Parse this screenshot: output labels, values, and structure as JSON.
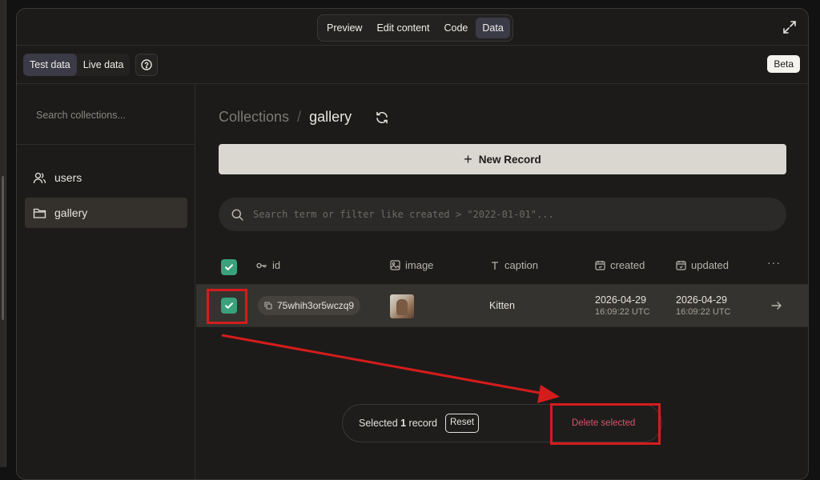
{
  "top_tabs": [
    "Preview",
    "Edit content",
    "Code",
    "Data"
  ],
  "active_top_tab": "Data",
  "env_tabs": [
    "Test data",
    "Live data"
  ],
  "active_env_tab": "Test data",
  "beta_label": "Beta",
  "sidebar": {
    "search_placeholder": "Search collections...",
    "items": [
      {
        "label": "users",
        "icon": "users-icon"
      },
      {
        "label": "gallery",
        "icon": "folder-icon",
        "active": true
      }
    ]
  },
  "breadcrumb": {
    "root": "Collections",
    "separator": "/",
    "current": "gallery"
  },
  "new_record_label": "New Record",
  "search": {
    "placeholder": "Search term or filter like created > \"2022-01-01\"..."
  },
  "table": {
    "columns": [
      {
        "label": "id",
        "icon": "key-icon"
      },
      {
        "label": "image",
        "icon": "image-icon"
      },
      {
        "label": "caption",
        "icon": "text-icon"
      },
      {
        "label": "created",
        "icon": "calendar-icon"
      },
      {
        "label": "updated",
        "icon": "calendar-icon"
      }
    ],
    "more_label": "···",
    "rows": [
      {
        "selected": true,
        "id": "75whih3or5wczq9",
        "caption": "Kitten",
        "created_date": "2026-04-29",
        "created_time": "16:09:22 UTC",
        "updated_date": "2026-04-29",
        "updated_time": "16:09:22 UTC"
      }
    ]
  },
  "selection": {
    "prefix": "Selected ",
    "count": "1",
    "suffix": " record",
    "reset_label": "Reset",
    "delete_label": "Delete selected"
  },
  "colors": {
    "accent_green": "#3aa17d",
    "annotation_red": "#d51c1c",
    "danger": "#e0506b"
  }
}
